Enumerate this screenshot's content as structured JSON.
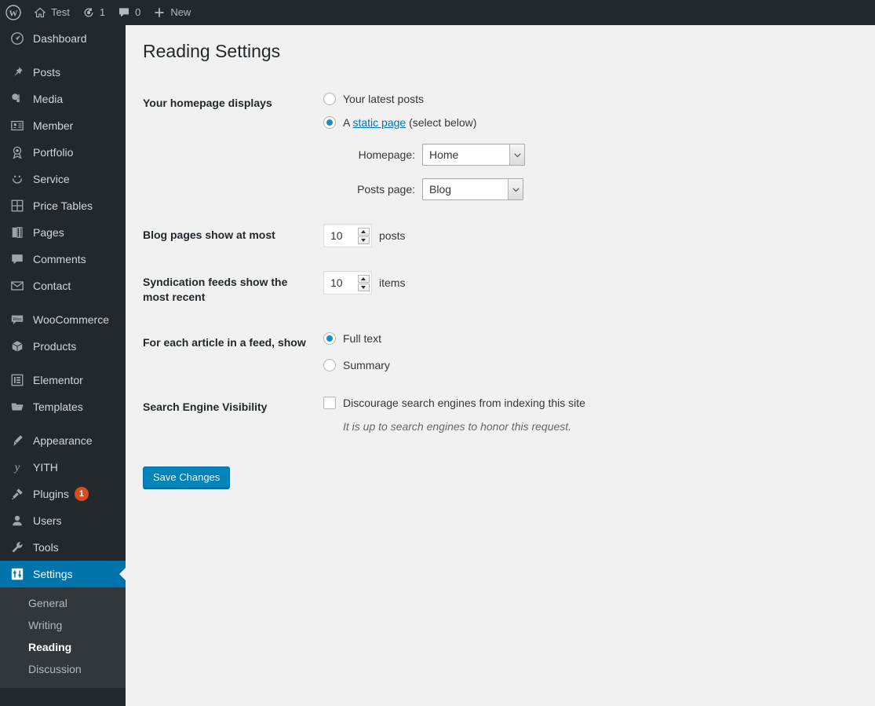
{
  "adminbar": {
    "logo_icon": "wordpress-logo-icon",
    "items": [
      {
        "icon": "home-icon",
        "label": "Test"
      },
      {
        "icon": "updates-icon",
        "label": "1"
      },
      {
        "icon": "comment-bubble-icon",
        "label": "0"
      },
      {
        "icon": "plus-icon",
        "label": "New"
      }
    ]
  },
  "sidebar": {
    "items": [
      {
        "icon": "dashboard-icon",
        "label": "Dashboard",
        "sep_after": true
      },
      {
        "icon": "pin-icon",
        "label": "Posts"
      },
      {
        "icon": "media-icon",
        "label": "Media"
      },
      {
        "icon": "member-card-icon",
        "label": "Member"
      },
      {
        "icon": "portfolio-award-icon",
        "label": "Portfolio"
      },
      {
        "icon": "smiley-icon",
        "label": "Service"
      },
      {
        "icon": "grid-icon",
        "label": "Price Tables"
      },
      {
        "icon": "pages-icon",
        "label": "Pages"
      },
      {
        "icon": "comment-bubble-icon",
        "label": "Comments"
      },
      {
        "icon": "envelope-icon",
        "label": "Contact",
        "sep_after": true
      },
      {
        "icon": "woocommerce-icon",
        "label": "WooCommerce"
      },
      {
        "icon": "products-box-icon",
        "label": "Products",
        "sep_after": true
      },
      {
        "icon": "elementor-icon",
        "label": "Elementor"
      },
      {
        "icon": "folder-icon",
        "label": "Templates",
        "sep_after": true
      },
      {
        "icon": "appearance-brush-icon",
        "label": "Appearance"
      },
      {
        "icon": "yith-icon",
        "label": "YITH"
      },
      {
        "icon": "plugins-plug-icon",
        "label": "Plugins",
        "badge": "1"
      },
      {
        "icon": "users-icon",
        "label": "Users"
      },
      {
        "icon": "tools-wrench-icon",
        "label": "Tools"
      },
      {
        "icon": "settings-sliders-icon",
        "label": "Settings",
        "current": true
      }
    ],
    "submenu": [
      {
        "label": "General"
      },
      {
        "label": "Writing"
      },
      {
        "label": "Reading",
        "current": true
      },
      {
        "label": "Discussion"
      }
    ]
  },
  "page": {
    "title": "Reading Settings",
    "homepage_displays": {
      "label": "Your homepage displays",
      "option_latest_posts": "Your latest posts",
      "option_static_prefix": "A ",
      "option_static_link": "static page",
      "option_static_suffix": " (select below)",
      "selected": "static_page",
      "homepage_label": "Homepage:",
      "homepage_value": "Home",
      "posts_page_label": "Posts page:",
      "posts_page_value": "Blog"
    },
    "blog_pages": {
      "label": "Blog pages show at most",
      "value": "10",
      "suffix": "posts"
    },
    "syndication": {
      "label": "Syndication feeds show the most recent",
      "value": "10",
      "suffix": "items"
    },
    "feed_article": {
      "label": "For each article in a feed, show",
      "option_full_text": "Full text",
      "option_summary": "Summary",
      "selected": "full_text"
    },
    "search_visibility": {
      "label": "Search Engine Visibility",
      "checkbox_label": "Discourage search engines from indexing this site",
      "checked": false,
      "description": "It is up to search engines to honor this request."
    },
    "save_button": "Save Changes"
  },
  "colors": {
    "sidebar_bg": "#23282d",
    "submenu_bg": "#32373c",
    "accent": "#0073aa",
    "button": "#0085ba",
    "badge": "#d54e21",
    "content_bg": "#f1f1f1"
  }
}
